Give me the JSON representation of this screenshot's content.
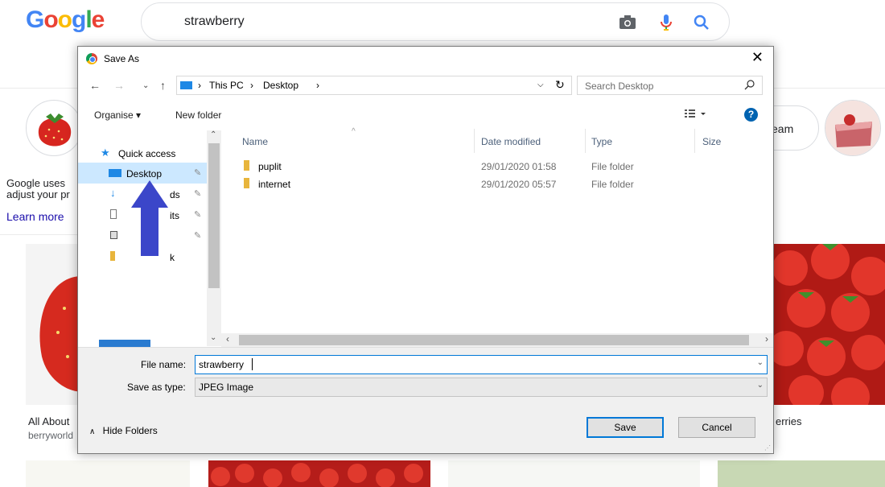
{
  "google": {
    "logo": [
      "G",
      "o",
      "o",
      "g",
      "l",
      "e"
    ],
    "logo_colors": [
      "#4285f4",
      "#ea4335",
      "#fbbc05",
      "#4285f4",
      "#34a853",
      "#ea4335"
    ],
    "search_value": "strawberry",
    "chip_text": "eam",
    "cookie_text_1": "Google uses",
    "cookie_text_2": "adjust your pr",
    "learn_more": "Learn more",
    "result1_title": "All About",
    "result1_source": "berryworld",
    "result2_title": "erries"
  },
  "dialog": {
    "title": "Save As",
    "breadcrumb": [
      "This PC",
      "Desktop"
    ],
    "search_placeholder": "Search Desktop",
    "organise_label": "Organise",
    "new_folder_label": "New folder",
    "nav": {
      "quick_access": "Quick access",
      "items": [
        {
          "label": "Desktop",
          "icon": "desktop-icon"
        },
        {
          "label": "ds",
          "icon": "download-icon"
        },
        {
          "label": "its",
          "icon": "document-icon"
        },
        {
          "label": "",
          "icon": "picture-icon"
        },
        {
          "label": "k",
          "icon": "folder-icon"
        }
      ]
    },
    "columns": [
      "Name",
      "Date modified",
      "Type",
      "Size"
    ],
    "files": [
      {
        "name": "puplit",
        "date": "29/01/2020 01:58",
        "type": "File folder"
      },
      {
        "name": "internet",
        "date": "29/01/2020 05:57",
        "type": "File folder"
      }
    ],
    "file_name_label": "File name:",
    "file_name_value": "strawberry",
    "save_type_label": "Save as type:",
    "save_type_value": "JPEG Image",
    "hide_folders_label": "Hide Folders",
    "save_label": "Save",
    "cancel_label": "Cancel"
  },
  "colors": {
    "annotation_arrow": "#3b46c9",
    "selection": "#cce8ff",
    "accent": "#0078d7"
  }
}
